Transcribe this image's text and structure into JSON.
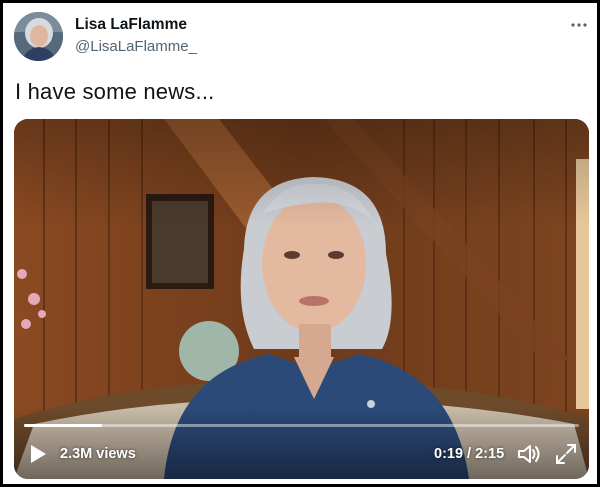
{
  "author": {
    "display_name": "Lisa LaFlamme",
    "handle": "@LisaLaFlamme_",
    "avatar_icon": "profile-photo"
  },
  "tweet": {
    "text": "I have some news..."
  },
  "video": {
    "views": "2.3M views",
    "time": "0:19 / 2:15",
    "progress_fraction": 0.14,
    "play_icon": "play-icon",
    "volume_icon": "volume-icon",
    "fullscreen_icon": "fullscreen-icon"
  },
  "colors": {
    "name": "#0f1419",
    "handle": "#536471",
    "frame": "#000000"
  }
}
